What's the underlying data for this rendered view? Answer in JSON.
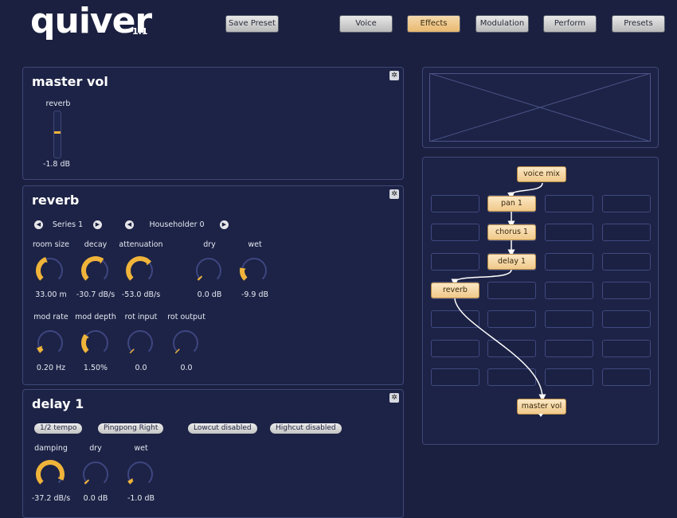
{
  "app": {
    "name": "quiver",
    "version": "1.1"
  },
  "toolbar": {
    "save_preset": "Save Preset",
    "tabs": [
      {
        "label": "Voice",
        "active": false
      },
      {
        "label": "Effects",
        "active": true
      },
      {
        "label": "Modulation",
        "active": false
      },
      {
        "label": "Perform",
        "active": false
      },
      {
        "label": "Presets",
        "active": false
      }
    ]
  },
  "master_vol": {
    "title": "master vol",
    "fader_label": "reverb",
    "fader_value": "-1.8 dB",
    "fader_level": 0.55
  },
  "reverb": {
    "title": "reverb",
    "selector1": "Series 1",
    "selector2": "Householder 0",
    "knobs_row1": [
      {
        "label": "room size",
        "value": "33.00 m",
        "level": 0.42
      },
      {
        "label": "decay",
        "value": "-30.7 dB/s",
        "level": 0.62
      },
      {
        "label": "attenuation",
        "value": "-53.0 dB/s",
        "level": 0.68
      },
      {
        "label": "dry",
        "value": "0.0 dB",
        "level": 0.02
      },
      {
        "label": "wet",
        "value": "-9.9 dB",
        "level": 0.2
      }
    ],
    "knobs_row2": [
      {
        "label": "mod rate",
        "value": "0.20 Hz",
        "level": 0.08
      },
      {
        "label": "mod depth",
        "value": "1.50%",
        "level": 0.3
      },
      {
        "label": "rot input",
        "value": "0.0",
        "level": 0.0
      },
      {
        "label": "rot output",
        "value": "0.0",
        "level": 0.0
      }
    ]
  },
  "delay": {
    "title": "delay 1",
    "options": [
      "1/2 tempo",
      "Pingpong Right",
      "Lowcut disabled",
      "Highcut disabled"
    ],
    "knobs": [
      {
        "label": "damping",
        "value": "-37.2 dB/s",
        "level": 0.92
      },
      {
        "label": "dry",
        "value": "0.0 dB",
        "level": 0.02
      },
      {
        "label": "wet",
        "value": "-1.0 dB",
        "level": 0.05
      }
    ]
  },
  "routing": {
    "nodes": {
      "voice_mix": "voice mix",
      "pan": "pan 1",
      "chorus": "chorus 1",
      "delay": "delay 1",
      "reverb": "reverb",
      "master": "master vol"
    }
  },
  "colors": {
    "bg": "#1b2040",
    "accent": "#f0b43a",
    "node": "#f0c98a"
  }
}
